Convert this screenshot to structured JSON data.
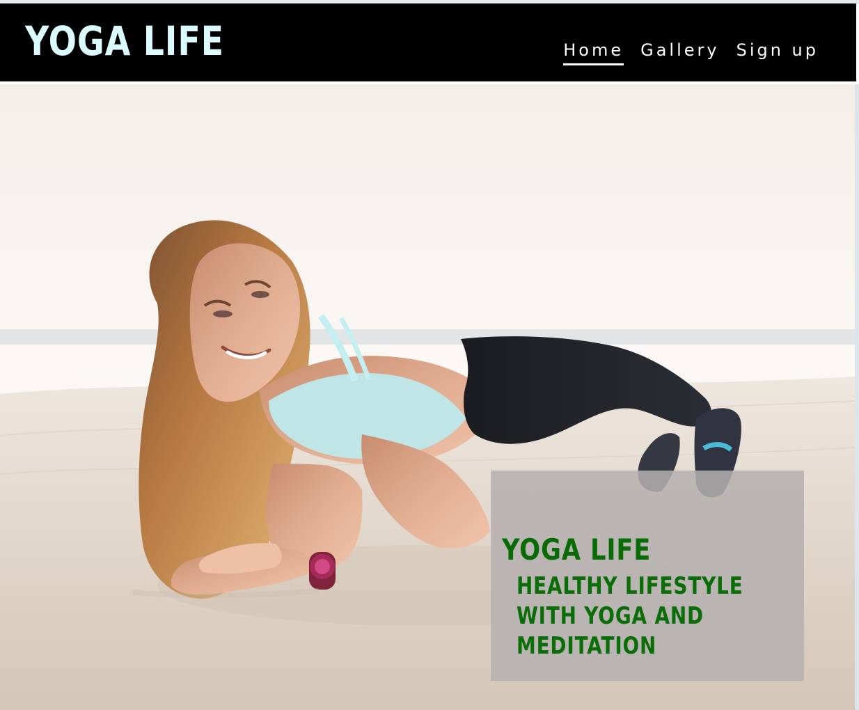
{
  "header": {
    "logo_text": "YOGA LIFE",
    "nav": [
      {
        "label": "Home",
        "active": true
      },
      {
        "label": "Gallery",
        "active": false
      },
      {
        "label": "Sign up",
        "active": false
      }
    ]
  },
  "hero": {
    "caption": {
      "title": "YOGA LIFE",
      "lines": [
        "HEALTHY LIFESTYLE",
        "WITH YOGA AND",
        "MEDITATION"
      ]
    }
  },
  "colors": {
    "header_bg": "#000000",
    "logo_color": "#dcfbff",
    "nav_text": "#ffffff",
    "caption_text": "#0b6d07",
    "caption_box": "#b4b0b0"
  }
}
